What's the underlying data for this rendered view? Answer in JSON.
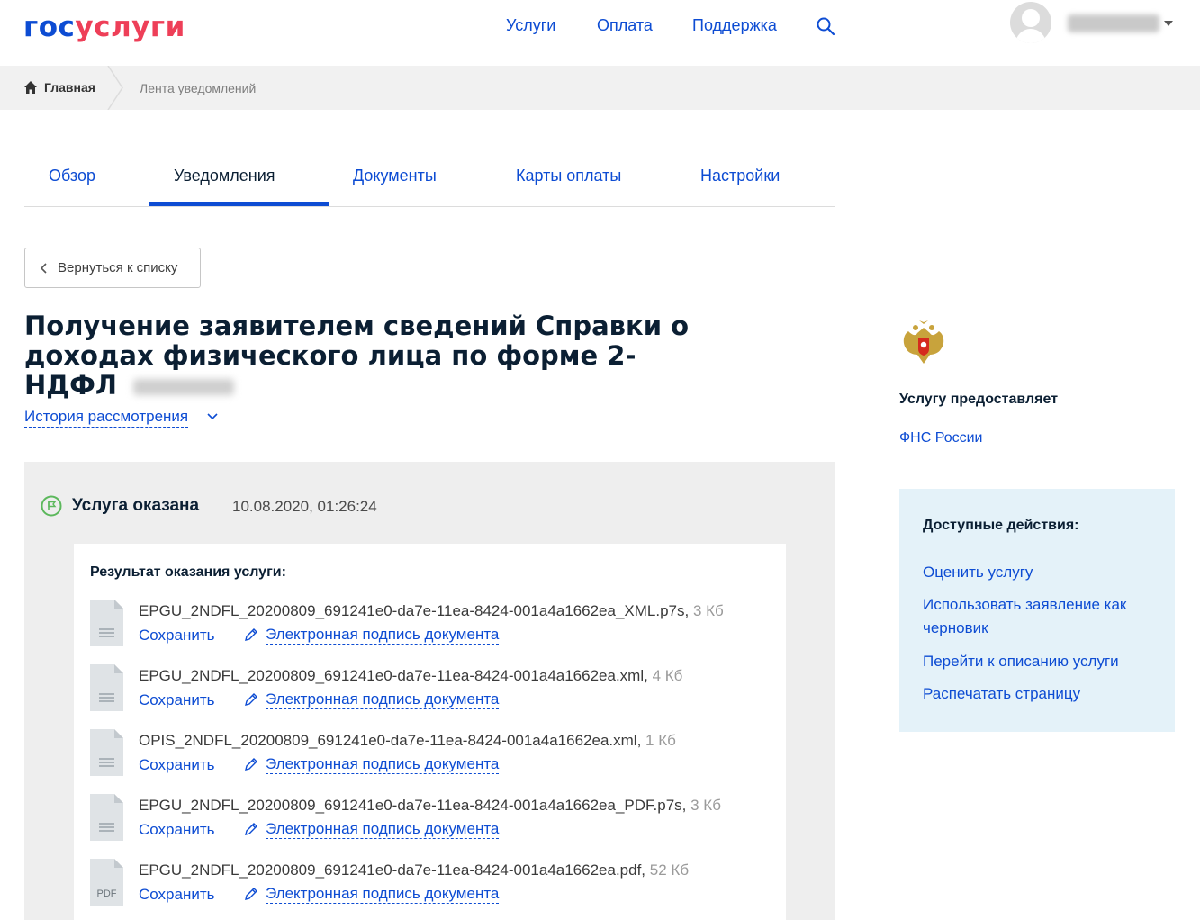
{
  "header": {
    "logo_part1": "гос",
    "logo_part2": "услуги",
    "nav": [
      "Услуги",
      "Оплата",
      "Поддержка"
    ]
  },
  "breadcrumb": {
    "home": "Главная",
    "current": "Лента уведомлений"
  },
  "tabs": [
    {
      "label": "Обзор",
      "active": false
    },
    {
      "label": "Уведомления",
      "active": true
    },
    {
      "label": "Документы",
      "active": false
    },
    {
      "label": "Карты оплаты",
      "active": false
    },
    {
      "label": "Настройки",
      "active": false
    }
  ],
  "back_button": "Вернуться к списку",
  "title": "Получение заявителем сведений Справки о доходах физического лица по форме 2-НДФЛ",
  "history_link": "История рассмотрения",
  "status": {
    "title": "Услуга оказана",
    "date": "10.08.2020, 01:26:24",
    "result_heading": "Результат оказания услуги:",
    "files": [
      {
        "name": "EPGU_2NDFL_20200809_691241e0-da7e-11ea-8424-001a4a1662ea_XML.p7s,",
        "size": "3 Кб",
        "type": "doc"
      },
      {
        "name": "EPGU_2NDFL_20200809_691241e0-da7e-11ea-8424-001a4a1662ea.xml,",
        "size": "4 Кб",
        "type": "doc"
      },
      {
        "name": "OPIS_2NDFL_20200809_691241e0-da7e-11ea-8424-001a4a1662ea.xml,",
        "size": "1 Кб",
        "type": "doc"
      },
      {
        "name": "EPGU_2NDFL_20200809_691241e0-da7e-11ea-8424-001a4a1662ea_PDF.p7s,",
        "size": "3 Кб",
        "type": "doc"
      },
      {
        "name": "EPGU_2NDFL_20200809_691241e0-da7e-11ea-8424-001a4a1662ea.pdf,",
        "size": "52 Кб",
        "type": "pdf"
      }
    ],
    "save_label": "Сохранить",
    "sign_label": "Электронная подпись документа",
    "pdf_badge": "PDF"
  },
  "sidebar": {
    "provider_label": "Услугу предоставляет",
    "provider_name": "ФНС России",
    "actions_title": "Доступные действия:",
    "actions": [
      "Оценить услугу",
      "Использовать заявление как черновик",
      "Перейти к описанию услуги",
      "Распечатать страницу"
    ]
  },
  "colors": {
    "link": "#0d4cd3",
    "logo_red": "#ee3f58",
    "status_green": "#5cb85c",
    "actions_bg": "#e4f2f9"
  }
}
